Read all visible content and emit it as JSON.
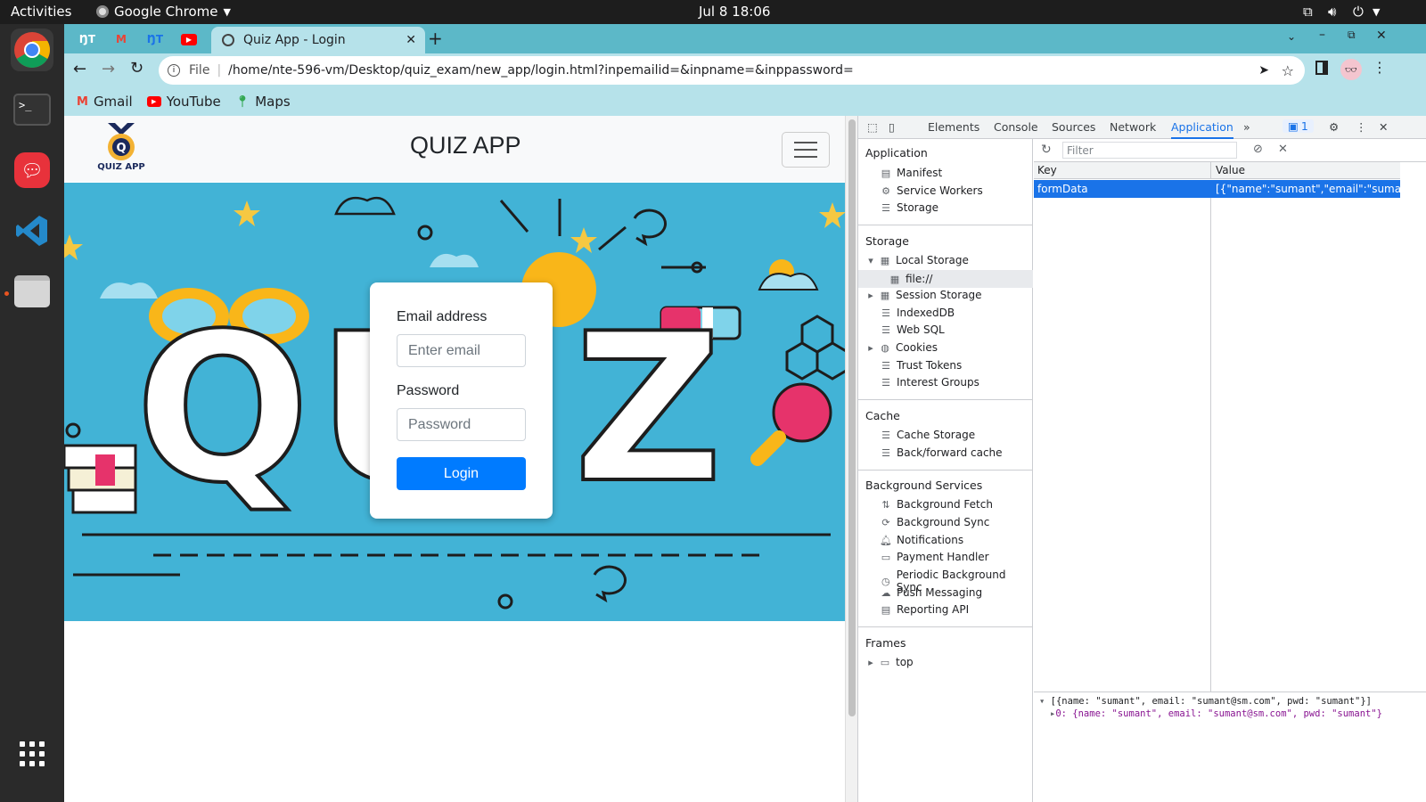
{
  "os": {
    "activities": "Activities",
    "app_name": "Google Chrome",
    "clock": "Jul 8  18:06"
  },
  "browser": {
    "active_tab_title": "Quiz App - Login",
    "url_scheme": "File",
    "url": "/home/nte-596-vm/Desktop/quiz_exam/new_app/login.html?inpemailid=&inpname=&inppassword=",
    "bookmarks": [
      "Gmail",
      "YouTube",
      "Maps"
    ]
  },
  "page": {
    "brand_logo_text": "QUIZ APP",
    "title": "QUIZ APP",
    "hero_word": "QUIZ",
    "login": {
      "email_label": "Email address",
      "email_placeholder": "Enter email",
      "password_label": "Password",
      "password_placeholder": "Password",
      "button": "Login"
    }
  },
  "devtools": {
    "tabs": [
      "Elements",
      "Console",
      "Sources",
      "Network",
      "Application"
    ],
    "active_tab": "Application",
    "issues_count": "1",
    "sidebar": {
      "application_head": "Application",
      "application_items": [
        "Manifest",
        "Service Workers",
        "Storage"
      ],
      "storage_head": "Storage",
      "storage_items": [
        "Local Storage",
        "file://",
        "Session Storage",
        "IndexedDB",
        "Web SQL",
        "Cookies",
        "Trust Tokens",
        "Interest Groups"
      ],
      "cache_head": "Cache",
      "cache_items": [
        "Cache Storage",
        "Back/forward cache"
      ],
      "bg_head": "Background Services",
      "bg_items": [
        "Background Fetch",
        "Background Sync",
        "Notifications",
        "Payment Handler",
        "Periodic Background Sync",
        "Push Messaging",
        "Reporting API"
      ],
      "frames_head": "Frames",
      "frames_items": [
        "top"
      ]
    },
    "filter_placeholder": "Filter",
    "table": {
      "key_header": "Key",
      "value_header": "Value",
      "row_key": "formData",
      "row_value": "[{\"name\":\"sumant\",\"email\":\"suma..."
    },
    "preview": {
      "line1": "[{name: \"sumant\", email: \"sumant@sm.com\", pwd: \"sumant\"}]",
      "line2": "0: {name: \"sumant\", email: \"sumant@sm.com\", pwd: \"sumant\"}"
    }
  },
  "colors": {
    "hero_bg": "#42b3d6",
    "login_button": "#007bff",
    "chrome_frame": "#5cb8c8",
    "selected_row": "#1a73e8"
  }
}
